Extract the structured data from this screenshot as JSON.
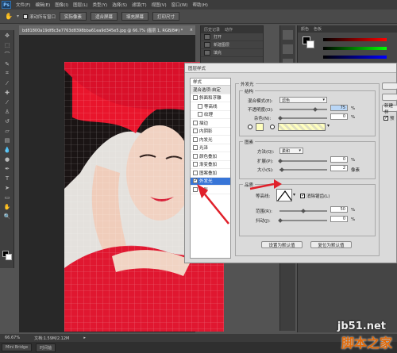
{
  "app": {
    "logo": "Ps",
    "menu": [
      "文件(F)",
      "编辑(E)",
      "图像(I)",
      "图层(L)",
      "类型(Y)",
      "选择(S)",
      "滤镜(T)",
      "视图(V)",
      "窗口(W)",
      "帮助(H)"
    ]
  },
  "options": {
    "scroll_all": "滚动所有窗口",
    "actual_pixels": "实际像素",
    "fit_screen": "适合屏幕",
    "fill_screen": "填充屏幕",
    "print_size": "打印尺寸"
  },
  "document": {
    "tab_title": "bd81800a19df8c3e7763d8398bba61ea9d345e5.jpg @ 66.7% (图层 1, RGB/8#) *",
    "zoom": "66.67%",
    "doc_info": "文档:1.59M/2.12M"
  },
  "bottom": {
    "mini_bridge": "Mini Bridge",
    "timeline": "时间轴"
  },
  "history_panel": {
    "tabs": [
      "历史记录",
      "动作"
    ],
    "items": [
      "打开",
      "新建图层",
      "填充"
    ]
  },
  "color_panel": {
    "tabs": [
      "颜色",
      "色板"
    ]
  },
  "dialog": {
    "title": "图层样式",
    "style_header": "样式",
    "styles": [
      {
        "label": "混合选项:自定",
        "checked": false
      },
      {
        "label": "斜面和浮雕",
        "checked": false
      },
      {
        "label": "等高线",
        "checked": false
      },
      {
        "label": "纹理",
        "checked": false
      },
      {
        "label": "描边",
        "checked": false
      },
      {
        "label": "内阴影",
        "checked": false
      },
      {
        "label": "内发光",
        "checked": false
      },
      {
        "label": "光泽",
        "checked": false
      },
      {
        "label": "颜色叠加",
        "checked": false
      },
      {
        "label": "渐变叠加",
        "checked": false
      },
      {
        "label": "图案叠加",
        "checked": false
      },
      {
        "label": "外发光",
        "checked": true
      },
      {
        "label": "投影",
        "checked": false
      }
    ],
    "outer_glow": "外发光",
    "structure": {
      "title": "结构",
      "blend_mode_label": "混合模式(E):",
      "blend_mode": "滤色",
      "opacity_label": "不透明度(O):",
      "opacity": "75",
      "noise_label": "杂色(N):",
      "noise": "0",
      "unit": "%"
    },
    "elements": {
      "title": "图素",
      "method_label": "方法(Q):",
      "method": "柔和",
      "spread_label": "扩展(P):",
      "spread": "0",
      "size_label": "大小(S):",
      "size": "2",
      "size_unit": "像素",
      "unit": "%"
    },
    "quality": {
      "title": "品质",
      "contour_label": "等高线:",
      "anti_alias": "消除锯齿(L)",
      "range_label": "范围(R):",
      "range": "50",
      "jitter_label": "抖动(J):",
      "jitter": "0",
      "unit": "%"
    },
    "set_default": "设置为默认值",
    "reset_default": "复位为默认值"
  },
  "right_buttons": {
    "new_style": "新建样",
    "preview": "预"
  },
  "watermark": {
    "site": "jb51.net",
    "brand": "脚本之家"
  },
  "colors": {
    "dialog_bg": "#dadada",
    "selected_row": "#3875d7",
    "arrow": "#e0202a",
    "glow_color": "#ffffbe"
  }
}
